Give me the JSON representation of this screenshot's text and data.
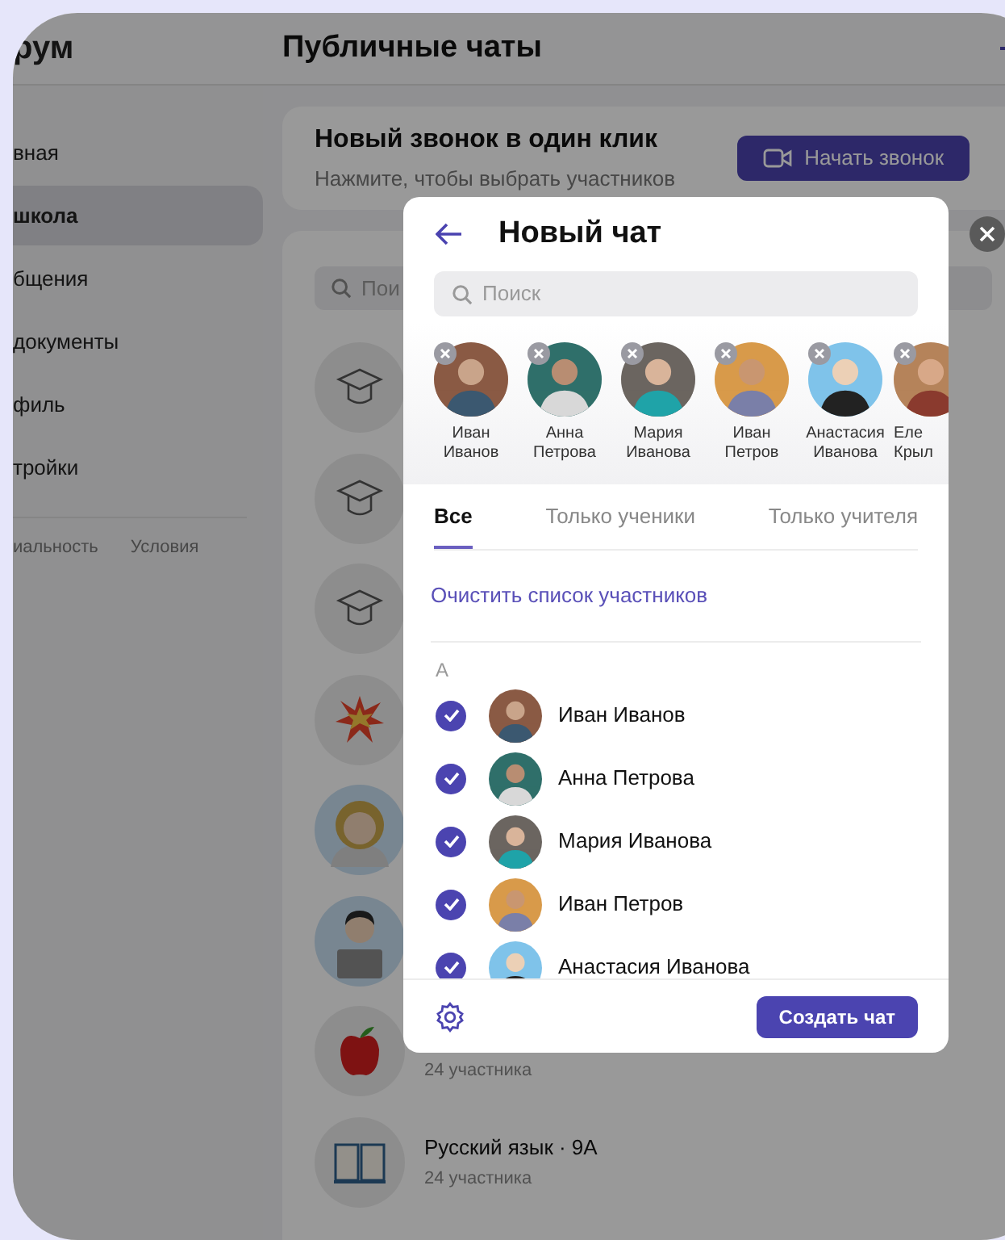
{
  "sidebar": {
    "title": "рум",
    "items": [
      {
        "label": "вная",
        "selected": false
      },
      {
        "label": "школа",
        "selected": true
      },
      {
        "label": "бщения",
        "selected": false
      },
      {
        "label": "документы",
        "selected": false
      },
      {
        "label": "филь",
        "selected": false
      },
      {
        "label": "тройки",
        "selected": false
      }
    ],
    "footer_links": [
      "иальность",
      "Условия"
    ]
  },
  "header": {
    "title": "Публичные чаты"
  },
  "call_card": {
    "title": "Новый звонок в один клик",
    "subtitle": "Нажмите, чтобы выбрать участников",
    "button": "Начать звонок"
  },
  "chat_list": {
    "search": {
      "placeholder": "Пои"
    },
    "chats": [
      {
        "kind": "cap"
      },
      {
        "kind": "cap"
      },
      {
        "kind": "cap"
      },
      {
        "kind": "explosion"
      },
      {
        "kind": "astronaut"
      },
      {
        "kind": "laptop"
      },
      {
        "kind": "apple",
        "members": "24 участника"
      },
      {
        "kind": "book",
        "name": "Русский язык · 9А",
        "members": "24 участника"
      }
    ]
  },
  "modal": {
    "title": "Новый чат",
    "search": {
      "placeholder": "Поиск"
    },
    "selected_people": [
      {
        "first": "Иван",
        "last": "Иванов"
      },
      {
        "first": "Анна",
        "last": "Петрова"
      },
      {
        "first": "Мария",
        "last": "Иванова"
      },
      {
        "first": "Иван",
        "last": "Петров"
      },
      {
        "first": "Анастасия",
        "last": "Иванова"
      },
      {
        "first": "Еле",
        "last": "Крыл"
      }
    ],
    "tabs": [
      {
        "label": "Все",
        "selected": true
      },
      {
        "label": "Только ученики",
        "selected": false
      },
      {
        "label": "Только учителя",
        "selected": false
      }
    ],
    "clear_link": "Очистить список участников",
    "section": "А",
    "participants": [
      {
        "name": "Иван Иванов",
        "checked": true
      },
      {
        "name": "Анна Петрова",
        "checked": true
      },
      {
        "name": "Мария Иванова",
        "checked": true
      },
      {
        "name": "Иван Петров",
        "checked": true
      },
      {
        "name": "Анастасия Иванова",
        "checked": true
      }
    ],
    "create_button": "Создать чат"
  }
}
